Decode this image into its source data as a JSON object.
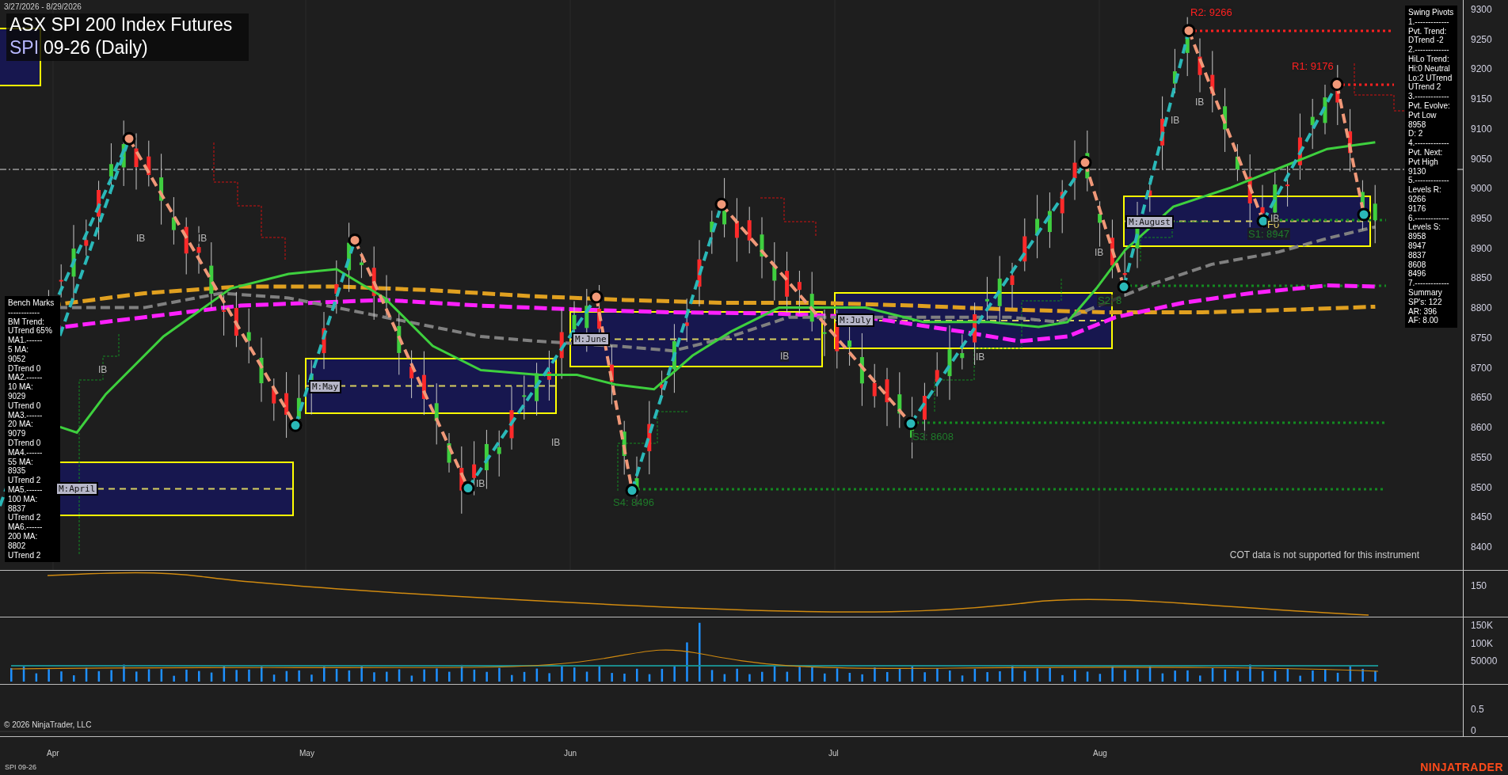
{
  "header": {
    "date_range": "3/27/2026 - 8/29/2026",
    "title": "ASX SPI 200 Index Futures",
    "symbol": "SPI",
    "contract": "09-26 (Daily)"
  },
  "bench_marks": {
    "lines": [
      "Bench Marks",
      "------------",
      "BM Trend:",
      "UTrend 65%",
      "MA1.------",
      "5 MA:",
      "9052",
      "DTrend 0",
      "MA2.------",
      "10 MA:",
      "9029",
      "UTrend 0",
      "MA3.------",
      "20 MA:",
      "9079",
      "DTrend 0",
      "MA4.------",
      "55 MA:",
      "8935",
      "UTrend 2",
      "MA5.------",
      "100 MA:",
      "8837",
      "UTrend 2",
      "MA6.------",
      "200 MA:",
      "8802",
      "UTrend 2"
    ]
  },
  "swing_pivots": {
    "lines": [
      "Swing Pivots",
      "1.-------------",
      "Pvt. Trend:",
      "DTrend -2",
      "2.-------------",
      "HiLo Trend:",
      "Hi:0 Neutral",
      "Lo:2 UTrend",
      "UTrend 2",
      "3.-------------",
      "Pvt. Evolve:",
      "Pvt Low",
      "8958",
      "D: 2",
      "4.-------------",
      "Pvt. Next:",
      "Pvt High",
      "9130",
      "5.-------------",
      "Levels R:",
      "9266",
      "9176",
      "6.-------------",
      "Levels S:",
      "8958",
      "8947",
      "8837",
      "8608",
      "8496",
      "7.-------------",
      "Summary",
      "SP's: 122",
      "AR: 396",
      "AF: 8.00"
    ]
  },
  "pivot_labels": [
    {
      "text": "R2: 9266",
      "kind": "resistance"
    },
    {
      "text": "R1: 9176",
      "kind": "resistance"
    },
    {
      "text": "S1: 8947",
      "kind": "support"
    },
    {
      "text": "S2: 8",
      "kind": "support"
    },
    {
      "text": "S3: 8608",
      "kind": "support"
    },
    {
      "text": "S4: 8496",
      "kind": "support"
    },
    {
      "text": "F0",
      "kind": "fib"
    }
  ],
  "month_boxes": [
    "M:April",
    "M:May",
    "M:June",
    "M:July",
    "M:August"
  ],
  "ib_markers": [
    "IB",
    "IB",
    "IB",
    "IB",
    "IB",
    "IB",
    "IB",
    "IB",
    "IB",
    "IB",
    "IB"
  ],
  "cot_note": "COT data is not supported for this instrument",
  "price_axis": {
    "ticks": [
      "9300",
      "9250",
      "9200",
      "9150",
      "9100",
      "9050",
      "9000",
      "8950",
      "8900",
      "8850",
      "8800",
      "8750",
      "8700",
      "8650",
      "8600",
      "8550",
      "8500",
      "8450",
      "8400"
    ]
  },
  "indicator_axis": {
    "ticks": [
      "150"
    ]
  },
  "volume_axis": {
    "ticks": [
      "150K",
      "100K",
      "50000"
    ]
  },
  "cot_axis": {
    "ticks": [
      "0.5",
      "0"
    ]
  },
  "time_axis": {
    "ticks": [
      "Apr",
      "May",
      "Jun",
      "Jul",
      "Aug"
    ]
  },
  "copyright": "© 2026 NinjaTrader, LLC",
  "status_bar": {
    "instrument": "SPI 09-26",
    "brand": "NINJATRADER"
  }
}
